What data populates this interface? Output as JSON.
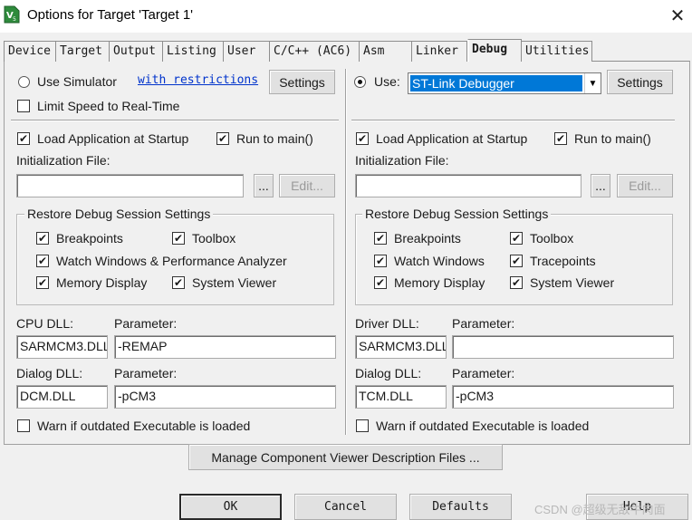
{
  "window": {
    "title": "Options for Target 'Target 1'",
    "icon": "keil-app-icon",
    "close_glyph": "✕"
  },
  "tabs": [
    {
      "label": "Device"
    },
    {
      "label": "Target"
    },
    {
      "label": "Output"
    },
    {
      "label": "Listing"
    },
    {
      "label": "User"
    },
    {
      "label": "C/C++ (AC6)"
    },
    {
      "label": "Asm"
    },
    {
      "label": "Linker"
    },
    {
      "label": "Debug",
      "active": true
    },
    {
      "label": "Utilities"
    }
  ],
  "left": {
    "use_simulator": {
      "label": "Use Simulator",
      "checked": false
    },
    "restrictions_link": "with restrictions",
    "settings_label": "Settings",
    "limit_speed": {
      "label": "Limit Speed to Real-Time",
      "checked": false
    },
    "load_app": {
      "label": "Load Application at Startup",
      "checked": true
    },
    "run_to_main": {
      "label": "Run to main()",
      "checked": true
    },
    "init_file_label": "Initialization File:",
    "init_file_value": "",
    "browse_label": "...",
    "edit_label": "Edit...",
    "restore_group": {
      "title": "Restore Debug Session Settings",
      "breakpoints": {
        "label": "Breakpoints",
        "checked": true
      },
      "toolbox": {
        "label": "Toolbox",
        "checked": true
      },
      "watch": {
        "label": "Watch Windows & Performance Analyzer",
        "checked": true
      },
      "memory": {
        "label": "Memory Display",
        "checked": true
      },
      "system_viewer": {
        "label": "System Viewer",
        "checked": true
      }
    },
    "cpu_dll_label": "CPU DLL:",
    "cpu_dll_value": "SARMCM3.DLL",
    "cpu_param_label": "Parameter:",
    "cpu_param_value": "-REMAP",
    "dialog_dll_label": "Dialog DLL:",
    "dialog_dll_value": "DCM.DLL",
    "dialog_param_label": "Parameter:",
    "dialog_param_value": "-pCM3",
    "warn": {
      "label": "Warn if outdated Executable is loaded",
      "checked": false
    }
  },
  "right": {
    "use": {
      "label": "Use:",
      "checked": true
    },
    "debugger_value": "ST-Link Debugger",
    "settings_label": "Settings",
    "load_app": {
      "label": "Load Application at Startup",
      "checked": true
    },
    "run_to_main": {
      "label": "Run to main()",
      "checked": true
    },
    "init_file_label": "Initialization File:",
    "init_file_value": "",
    "browse_label": "...",
    "edit_label": "Edit...",
    "restore_group": {
      "title": "Restore Debug Session Settings",
      "breakpoints": {
        "label": "Breakpoints",
        "checked": true
      },
      "toolbox": {
        "label": "Toolbox",
        "checked": true
      },
      "watch": {
        "label": "Watch Windows",
        "checked": true
      },
      "tracepoints": {
        "label": "Tracepoints",
        "checked": true
      },
      "memory": {
        "label": "Memory Display",
        "checked": true
      },
      "system_viewer": {
        "label": "System Viewer",
        "checked": true
      }
    },
    "driver_dll_label": "Driver DLL:",
    "driver_dll_value": "SARMCM3.DLL",
    "driver_param_label": "Parameter:",
    "driver_param_value": "",
    "dialog_dll_label": "Dialog DLL:",
    "dialog_dll_value": "TCM.DLL",
    "dialog_param_label": "Parameter:",
    "dialog_param_value": "-pCM3",
    "warn": {
      "label": "Warn if outdated Executable is loaded",
      "checked": false
    }
  },
  "manage_button": "Manage Component Viewer Description Files ...",
  "footer": {
    "ok": "OK",
    "cancel": "Cancel",
    "defaults": "Defaults",
    "help": "Help"
  },
  "watermark": "CSDN @超级无敌牛肉面",
  "check_glyph": "✔"
}
